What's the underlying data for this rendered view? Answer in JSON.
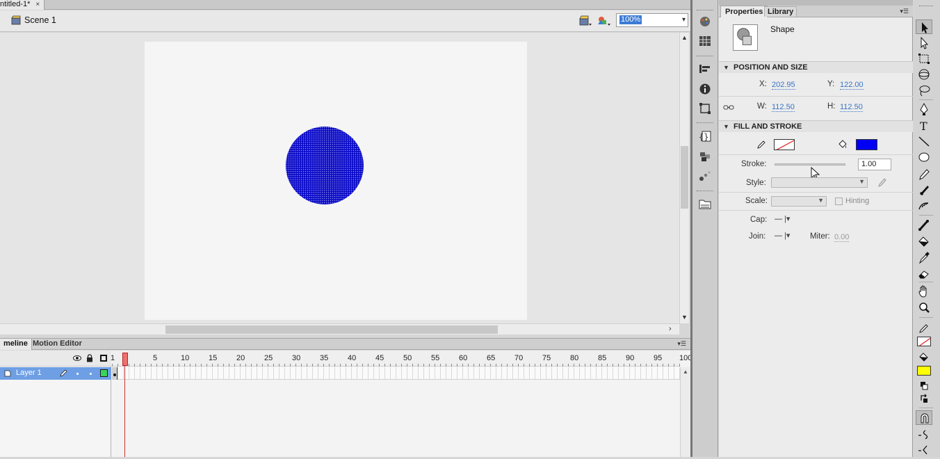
{
  "document": {
    "tab_title": "ntitled-1*",
    "tab_close": "×",
    "scene_label": "Scene 1",
    "zoom_value": "100%",
    "zoom_arrow": "▾"
  },
  "stage": {
    "background_color": "#f5f5f5",
    "shape_fill_color": "#0a0ac8"
  },
  "timeline": {
    "tabs": [
      {
        "label": "meline"
      },
      {
        "label": "Motion Editor"
      }
    ],
    "layer_name": "Layer 1",
    "layer_color": "#3bd45b",
    "current_frame": "1",
    "ruler_labels": [
      "5",
      "10",
      "15",
      "20",
      "25",
      "30",
      "35",
      "40",
      "45",
      "50",
      "55",
      "60",
      "65",
      "70",
      "75",
      "80",
      "85",
      "90",
      "95",
      "100"
    ]
  },
  "properties_panel": {
    "tabs": [
      {
        "label": "Properties"
      },
      {
        "label": "Library"
      }
    ],
    "selection_type": "Shape",
    "position_size": {
      "title": "POSITION AND SIZE",
      "x_label": "X:",
      "x_value": "202.95",
      "y_label": "Y:",
      "y_value": "122.00",
      "w_label": "W:",
      "w_value": "112.50",
      "h_label": "H:",
      "h_value": "112.50"
    },
    "fill_stroke": {
      "title": "FILL AND STROKE",
      "stroke_color": "none",
      "fill_color": "#0000f5",
      "stroke_label": "Stroke:",
      "stroke_value": "1.00",
      "style_label": "Style:",
      "scale_label": "Scale:",
      "hinting_label": "Hinting",
      "cap_label": "Cap:",
      "cap_value": "—",
      "join_label": "Join:",
      "join_value": "—",
      "miter_label": "Miter:",
      "miter_value": "0.00"
    }
  },
  "tools": {
    "active_tool": "selection-tool",
    "fill_color": "#ffff00",
    "stroke_color": "none"
  },
  "icons": [
    "scene-icon",
    "edit-scene-icon",
    "edit-symbol-icon",
    "eye-icon",
    "lock-icon",
    "outline-icon",
    "pencil-icon",
    "color-panel-icon",
    "swatches-icon",
    "align-icon",
    "info-icon",
    "transform-icon",
    "actions-icon",
    "components-icon",
    "motion-presets-icon",
    "project-icon",
    "selection-tool-icon",
    "subselection-tool-icon",
    "free-transform-icon",
    "3d-rotation-icon",
    "lasso-icon",
    "pen-icon",
    "text-icon",
    "line-icon",
    "oval-icon",
    "pencil-tool-icon",
    "brush-icon",
    "deco-icon",
    "bone-icon",
    "paint-bucket-icon",
    "eyedropper-icon",
    "eraser-icon",
    "hand-icon",
    "zoom-icon",
    "stroke-color-icon",
    "fill-color-icon",
    "snap-icon"
  ]
}
